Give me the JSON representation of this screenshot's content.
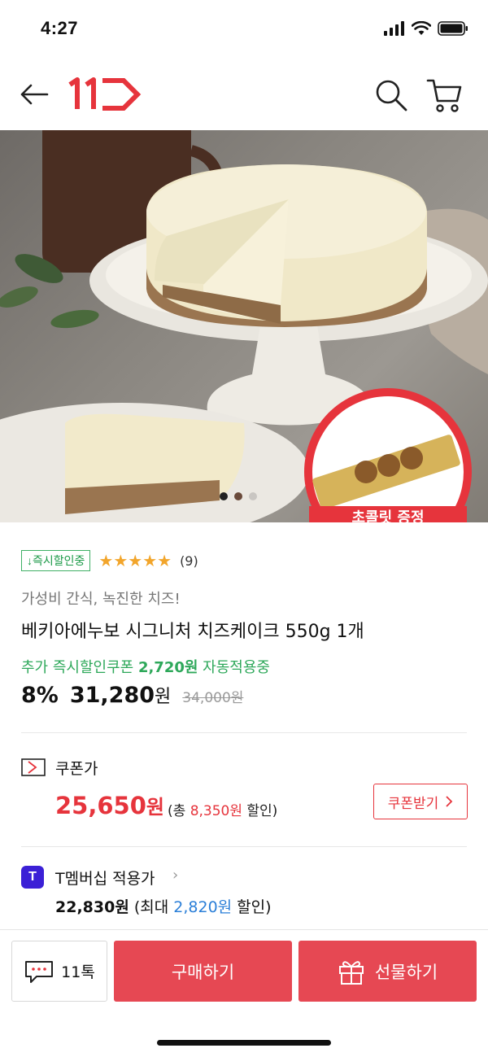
{
  "status": {
    "time": "4:27"
  },
  "nav": {
    "logo_text": "11"
  },
  "hero": {
    "slide_count": 3,
    "active_slide": 1,
    "promo_text": "초콜릿 증정"
  },
  "product": {
    "instant_badge": "↓즉시할인중",
    "stars": "★★★★★",
    "review_count": "(9)",
    "subtitle": "가성비 간식, 녹진한 치즈!",
    "title": "베키아에누보 시그니처 치즈케이크 550g 1개",
    "coupon_prefix": "추가 즉시할인쿠폰 ",
    "coupon_amount": "2,720원",
    "coupon_suffix": " 자동적용중",
    "discount": "8%",
    "price": "31,280",
    "price_unit": "원",
    "original_price": "34,000원"
  },
  "coupon": {
    "label": "쿠폰가",
    "price": "25,650",
    "price_unit": "원",
    "total_prefix": "(총 ",
    "total_amount": "8,350원",
    "total_suffix": " 할인)",
    "button_label": "쿠폰받기"
  },
  "tmember": {
    "icon_letter": "T",
    "label": "T멤버십 적용가",
    "price": "22,830원",
    "max_prefix": " (최대 ",
    "max_amount": "2,820원",
    "max_suffix": " 할인)"
  },
  "bottom": {
    "talk_label": "11톡",
    "buy_label": "구매하기",
    "gift_label": "선물하기"
  },
  "colors": {
    "brand_red": "#e6343c",
    "button_red": "#e64853",
    "green": "#2ea85a",
    "star": "#f2a52b",
    "tmember_blue": "#3b20d6"
  }
}
